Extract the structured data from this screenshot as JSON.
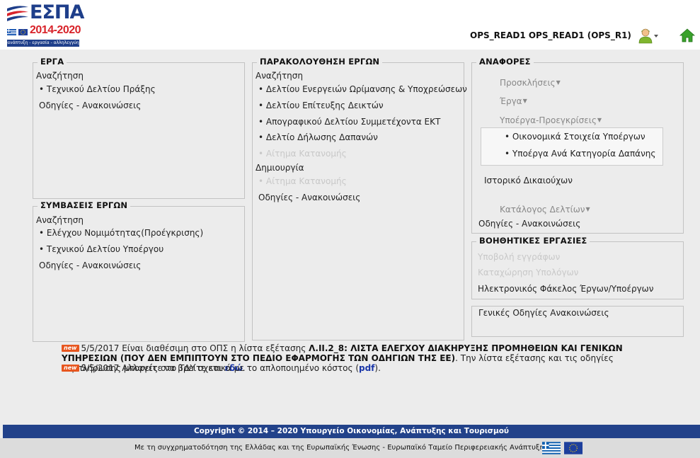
{
  "header": {
    "logo_word": "ΕΣΠΑ",
    "logo_years": "2014-2020",
    "logo_tagline": "ανάπτυξη - εργασία - αλληλεγγύη",
    "user_label": "OPS_READ1 OPS_READ1 (OPS_R1)"
  },
  "erga": {
    "title": "ΕΡΓΑ",
    "search_label": "Αναζήτηση",
    "items": [
      "Τεχνικού Δελτίου Πράξης"
    ],
    "guidelines": "Οδηγίες - Ανακοινώσεις"
  },
  "symvaseis": {
    "title": "ΣΥΜΒΑΣΕΙΣ ΕΡΓΩΝ",
    "search_label": "Αναζήτηση",
    "items": [
      "Ελέγχου Νομιμότητας(Προέγκρισης)",
      "Τεχνικού Δελτίου Υποέργου"
    ],
    "guidelines": "Οδηγίες - Ανακοινώσεις"
  },
  "parakolouthisi": {
    "title": "ΠΑΡΑΚΟΛΟΥΘΗΣΗ ΕΡΓΩΝ",
    "search_label": "Αναζήτηση",
    "items": [
      "Δελτίου Ενεργειών Ωρίμανσης & Υποχρεώσεων",
      "Δελτίου Επίτευξης Δεικτών",
      "Απογραφικού Δελτίου Συμμετέχοντα ΕΚΤ",
      "Δελτίο Δήλωσης Δαπανών",
      "Αίτημα Κατανομής"
    ],
    "create_label": "Δημιουργία",
    "create_items": [
      "Αίτημα Κατανομής"
    ],
    "guidelines": "Οδηγίες - Ανακοινώσεις"
  },
  "anafores": {
    "title": "ΑΝΑΦΟΡΕΣ",
    "menus": [
      "Προσκλήσεις",
      "Έργα",
      "Υποέργα-Προεγκρίσεις"
    ],
    "sub_items": [
      "Οικονομικά Στοιχεία Υποέργων",
      "Υποέργα Ανά Κατηγορία Δαπάνης"
    ],
    "history": "Ιστορικό Δικαιούχων",
    "catalog": "Κατάλογος Δελτίων",
    "guidelines": "Οδηγίες - Ανακοινώσεις"
  },
  "voithitikes": {
    "title": "ΒΟΗΘΗΤΙΚΕΣ ΕΡΓΑΣΙΕΣ",
    "items": [
      "Υποβολή εγγράφων",
      "Καταχώρηση Υπολόγων",
      "Ηλεκτρονικός Φάκελος Έργων/Υποέργων"
    ]
  },
  "general": {
    "guidelines": "Γενικές Οδηγίες Ανακοινώσεις"
  },
  "news": {
    "badge": "new",
    "n1_prefix": "5/5/2017 Είναι διαθέσιμη στο ΟΠΣ η λίστα εξέτασης",
    "n1_bold": "Λ.ΙΙ.2_8: ΛΙΣΤΑ ΕΛΕΓΧΟΥ ΔΙΑΚΗΡΥΞΗΣ ΠΡΟΜΗΘΕΙΩΝ ΚΑΙ ΓΕΝΙΚΩΝ ΥΠΗΡΕΣΙΩΝ (ΠΟΥ ΔΕΝ ΕΜΠΙΠΤΟΥΝ ΣΤΟ ΠΕΔΙΟ ΕΦΑΡΜΟΓΗΣ ΤΩΝ ΟΔΗΓΙΩΝ ΤΗΣ ΕΕ)",
    "n1_suffix": ". Την λίστα εξέτασης και τις οδηγίες συμπλήρωσης μπορείτε να βρείτε και",
    "n1_link": "εδώ",
    "n2_prefix": "5/5/2017 Αλλαγές στο ΤΔΥ σχετικά με το απλοποιημένο κόστος (",
    "n2_link": "pdf",
    "n2_suffix": ")."
  },
  "footer": {
    "copyright": "Copyright © 2014 – 2020 Υπουργείο Οικονομίας, Ανάπτυξης και Τουρισμού",
    "cofunding": "Με τη συγχρηματοδότηση της Ελλάδας και της Ευρωπαϊκής Ένωσης - Ευρωπαϊκό Ταμείο Περιφερειακής Ανάπτυξης"
  },
  "colors": {
    "brand_blue": "#22428a",
    "brand_red": "#d8232a",
    "badge_orange": "#e7561f",
    "link_blue": "#1a36a8"
  }
}
